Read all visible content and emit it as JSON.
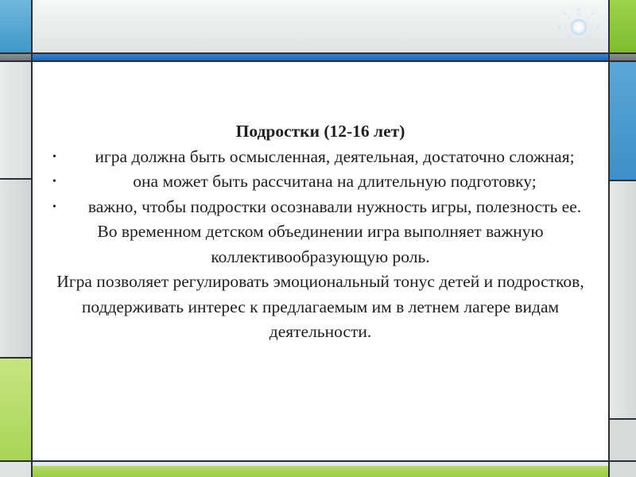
{
  "slide": {
    "heading": "Подростки (12-16 лет)",
    "bullets": [
      {
        "text": "игра должна быть осмысленная, деятельная, достаточно сложная;"
      },
      {
        "text": "она может быть рассчитана на длительную подготовку;"
      },
      {
        "text": "важно, чтобы подростки осознавали нужность игры, полезность ее."
      }
    ],
    "paragraphs": [
      "Во временном детском объединении игра выполняет важную коллективообразующую роль.",
      "Игра позволяет регулировать эмоциональный тонус детей и подростков, поддерживать интерес к предлагаемым им в летнем лагере видам деятельности."
    ]
  },
  "decor": {
    "logo_icon": "sun-icon",
    "colors": {
      "blue": "#3f86d3",
      "green": "#9ccb45",
      "gray": "#dfe3e3",
      "dark": "#6c737a"
    }
  }
}
